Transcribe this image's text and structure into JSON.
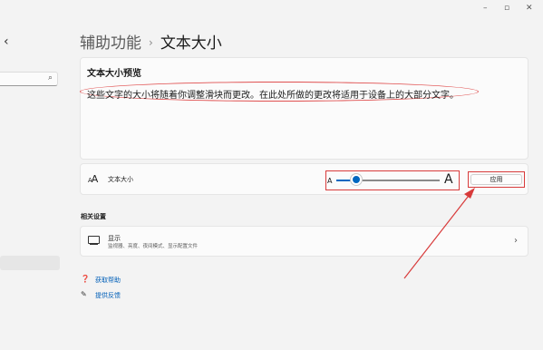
{
  "window": {
    "controls": [
      "–",
      "▫",
      "✕"
    ]
  },
  "sidebar": {
    "search_icon": "⌕",
    "back_glyph": "‹"
  },
  "header": {
    "parent": "辅助功能",
    "separator": "›",
    "title": "文本大小"
  },
  "preview": {
    "title": "文本大小预览",
    "text": "这些文字的大小将随着你调整滑块而更改。在此处所做的更改将适用于设备上的大部分文字。"
  },
  "text_size": {
    "icon_text_small": "A",
    "icon_text_big": "A",
    "label": "文本大小",
    "slider_min_label": "A",
    "slider_max_label": "A",
    "slider_value_fraction": 0.2,
    "apply_label": "应用"
  },
  "related": {
    "heading": "相关设置",
    "display": {
      "title": "显示",
      "subtitle": "监视器、亮度、夜间模式、显示配置文件",
      "chevron": "›"
    }
  },
  "help": {
    "get_help": "获取帮助",
    "feedback": "提供反馈"
  },
  "colors": {
    "accent": "#0067c0",
    "annotation": "#d83b3b",
    "link": "#005fb8"
  }
}
